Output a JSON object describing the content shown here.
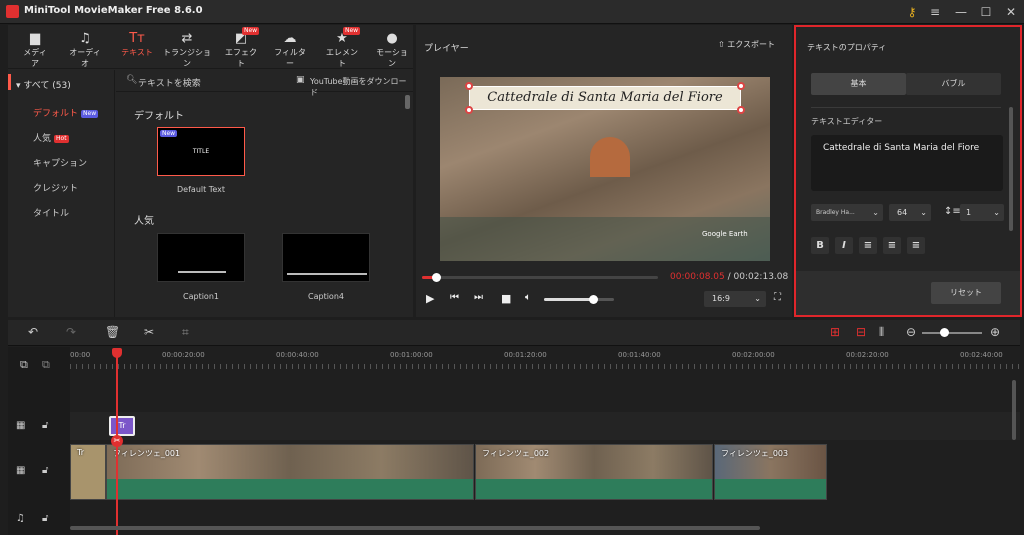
{
  "app": {
    "title": "MiniTool MovieMaker Free 8.6.0"
  },
  "toolbar": {
    "items": [
      {
        "label": "メディア",
        "icon": "folder-icon"
      },
      {
        "label": "オーディオ",
        "icon": "music-note-icon"
      },
      {
        "label": "テキスト",
        "icon": "text-tt-icon"
      },
      {
        "label": "トランジション",
        "icon": "transition-arrows-icon"
      },
      {
        "label": "エフェクト",
        "icon": "effect-icon",
        "badge": "New"
      },
      {
        "label": "フィルター",
        "icon": "filter-cloud-icon"
      },
      {
        "label": "エレメント",
        "icon": "element-star-icon",
        "badge": "New"
      },
      {
        "label": "モーション",
        "icon": "motion-icon"
      }
    ]
  },
  "categories": {
    "all": "すべて (53)",
    "items": [
      {
        "label": "デフォルト",
        "badge": "New"
      },
      {
        "label": "人気",
        "badge": "Hot"
      },
      {
        "label": "キャプション"
      },
      {
        "label": "クレジット"
      },
      {
        "label": "タイトル"
      }
    ]
  },
  "library": {
    "search_placeholder": "テキストを検索",
    "youtube": "YouTube動画をダウンロード",
    "sections": [
      {
        "title": "デフォルト"
      },
      {
        "title": "人気"
      }
    ],
    "default_thumb": {
      "badge": "New",
      "text": "TITLE",
      "label": "Default Text"
    },
    "caption1": {
      "label": "Caption1"
    },
    "caption4": {
      "label": "Caption4"
    }
  },
  "player": {
    "title": "プレイヤー",
    "export": "エクスポート",
    "overlay_text": "Cattedrale di Santa Maria del Fiore",
    "watermark": "Google Earth",
    "current_time": "00:00:08.05",
    "separator": " / ",
    "total_time": "00:02:13.08",
    "aspect": "16:9",
    "progress": 0.06,
    "volume": 0.7
  },
  "props": {
    "title": "テキストのプロパティ",
    "tab_basic": "基本",
    "tab_bubble": "バブル",
    "editor_label": "テキストエディター",
    "editor_text": "Cattedrale di Santa Maria del Fiore",
    "font_name": "Bradley Ha...",
    "font_size": "64",
    "line_spacing": "1",
    "reset": "リセット"
  },
  "timeline": {
    "ruler": [
      "00:00",
      "00:00:20:00",
      "00:00:40:00",
      "00:01:00:00",
      "00:01:20:00",
      "00:01:40:00",
      "00:02:00:00",
      "00:02:20:00",
      "00:02:40:00"
    ],
    "clips": [
      {
        "label": "フィレンツェ_001"
      },
      {
        "label": "フィレンツェ_002"
      },
      {
        "label": "フィレンツェ_003"
      }
    ],
    "title_clip": "Tr",
    "text_clip": "Tr"
  },
  "colors": {
    "accent": "#ff5a4a",
    "highlight": "#e0262b",
    "audio": "#2e7d5b"
  }
}
